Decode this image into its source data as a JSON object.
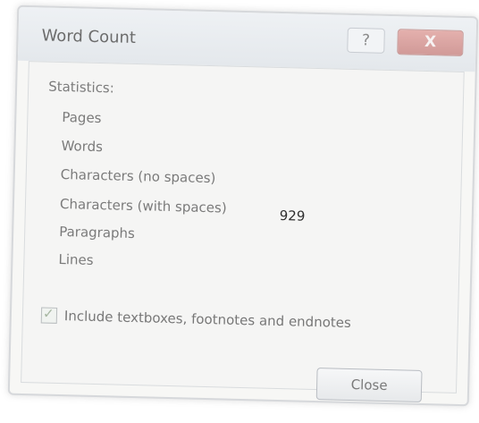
{
  "window": {
    "title": "Word Count",
    "help_label": "?",
    "close_x_label": "X"
  },
  "statistics": {
    "heading": "Statistics:",
    "rows": [
      {
        "label": "Pages",
        "value": ""
      },
      {
        "label": "Words",
        "value": ""
      },
      {
        "label": "Characters (no spaces)",
        "value": ""
      },
      {
        "label": "Characters (with spaces)",
        "value": "929"
      },
      {
        "label": "Paragraphs",
        "value": ""
      },
      {
        "label": "Lines",
        "value": ""
      }
    ]
  },
  "option": {
    "checked": true,
    "label": "Include textboxes, footnotes and endnotes"
  },
  "buttons": {
    "close_label": "Close"
  },
  "colors": {
    "dialog_bg": "#f7f7f5",
    "close_x_bg": "#d19a98",
    "text_muted": "#7a7a7a",
    "value_text": "#2e2e2e"
  },
  "icons": {
    "help": "question-mark-icon",
    "close": "close-icon",
    "checkbox": "checkmark-icon"
  }
}
